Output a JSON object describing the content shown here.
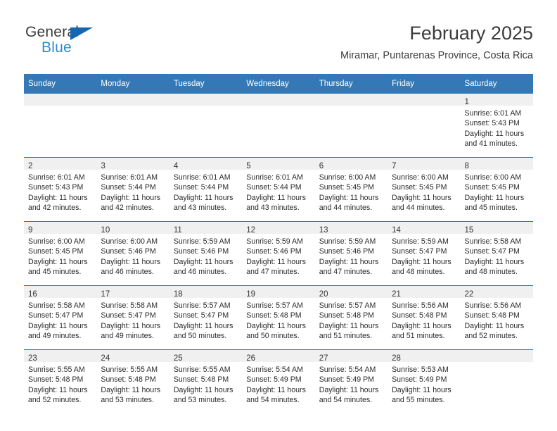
{
  "brand": {
    "name_top": "General",
    "name_bottom": "Blue",
    "flag_icon": "blue-triangle-flag",
    "accent_dark": "#1567b2",
    "accent_light": "#2b8ccc"
  },
  "header": {
    "title": "February 2025",
    "subtitle": "Miramar, Puntarenas Province, Costa Rica"
  },
  "theme": {
    "header_row_bg": "#3479b5",
    "header_row_text": "#ffffff",
    "daynum_band_bg": "#f0f0f0",
    "row_divider": "#3479b5"
  },
  "weekdays": [
    "Sunday",
    "Monday",
    "Tuesday",
    "Wednesday",
    "Thursday",
    "Friday",
    "Saturday"
  ],
  "weeks": [
    [
      {
        "day": "",
        "empty": true
      },
      {
        "day": "",
        "empty": true
      },
      {
        "day": "",
        "empty": true
      },
      {
        "day": "",
        "empty": true
      },
      {
        "day": "",
        "empty": true
      },
      {
        "day": "",
        "empty": true
      },
      {
        "day": "1",
        "sunrise": "Sunrise: 6:01 AM",
        "sunset": "Sunset: 5:43 PM",
        "daylight_1": "Daylight: 11 hours",
        "daylight_2": "and 41 minutes."
      }
    ],
    [
      {
        "day": "2",
        "sunrise": "Sunrise: 6:01 AM",
        "sunset": "Sunset: 5:43 PM",
        "daylight_1": "Daylight: 11 hours",
        "daylight_2": "and 42 minutes."
      },
      {
        "day": "3",
        "sunrise": "Sunrise: 6:01 AM",
        "sunset": "Sunset: 5:44 PM",
        "daylight_1": "Daylight: 11 hours",
        "daylight_2": "and 42 minutes."
      },
      {
        "day": "4",
        "sunrise": "Sunrise: 6:01 AM",
        "sunset": "Sunset: 5:44 PM",
        "daylight_1": "Daylight: 11 hours",
        "daylight_2": "and 43 minutes."
      },
      {
        "day": "5",
        "sunrise": "Sunrise: 6:01 AM",
        "sunset": "Sunset: 5:44 PM",
        "daylight_1": "Daylight: 11 hours",
        "daylight_2": "and 43 minutes."
      },
      {
        "day": "6",
        "sunrise": "Sunrise: 6:00 AM",
        "sunset": "Sunset: 5:45 PM",
        "daylight_1": "Daylight: 11 hours",
        "daylight_2": "and 44 minutes."
      },
      {
        "day": "7",
        "sunrise": "Sunrise: 6:00 AM",
        "sunset": "Sunset: 5:45 PM",
        "daylight_1": "Daylight: 11 hours",
        "daylight_2": "and 44 minutes."
      },
      {
        "day": "8",
        "sunrise": "Sunrise: 6:00 AM",
        "sunset": "Sunset: 5:45 PM",
        "daylight_1": "Daylight: 11 hours",
        "daylight_2": "and 45 minutes."
      }
    ],
    [
      {
        "day": "9",
        "sunrise": "Sunrise: 6:00 AM",
        "sunset": "Sunset: 5:45 PM",
        "daylight_1": "Daylight: 11 hours",
        "daylight_2": "and 45 minutes."
      },
      {
        "day": "10",
        "sunrise": "Sunrise: 6:00 AM",
        "sunset": "Sunset: 5:46 PM",
        "daylight_1": "Daylight: 11 hours",
        "daylight_2": "and 46 minutes."
      },
      {
        "day": "11",
        "sunrise": "Sunrise: 5:59 AM",
        "sunset": "Sunset: 5:46 PM",
        "daylight_1": "Daylight: 11 hours",
        "daylight_2": "and 46 minutes."
      },
      {
        "day": "12",
        "sunrise": "Sunrise: 5:59 AM",
        "sunset": "Sunset: 5:46 PM",
        "daylight_1": "Daylight: 11 hours",
        "daylight_2": "and 47 minutes."
      },
      {
        "day": "13",
        "sunrise": "Sunrise: 5:59 AM",
        "sunset": "Sunset: 5:46 PM",
        "daylight_1": "Daylight: 11 hours",
        "daylight_2": "and 47 minutes."
      },
      {
        "day": "14",
        "sunrise": "Sunrise: 5:59 AM",
        "sunset": "Sunset: 5:47 PM",
        "daylight_1": "Daylight: 11 hours",
        "daylight_2": "and 48 minutes."
      },
      {
        "day": "15",
        "sunrise": "Sunrise: 5:58 AM",
        "sunset": "Sunset: 5:47 PM",
        "daylight_1": "Daylight: 11 hours",
        "daylight_2": "and 48 minutes."
      }
    ],
    [
      {
        "day": "16",
        "sunrise": "Sunrise: 5:58 AM",
        "sunset": "Sunset: 5:47 PM",
        "daylight_1": "Daylight: 11 hours",
        "daylight_2": "and 49 minutes."
      },
      {
        "day": "17",
        "sunrise": "Sunrise: 5:58 AM",
        "sunset": "Sunset: 5:47 PM",
        "daylight_1": "Daylight: 11 hours",
        "daylight_2": "and 49 minutes."
      },
      {
        "day": "18",
        "sunrise": "Sunrise: 5:57 AM",
        "sunset": "Sunset: 5:47 PM",
        "daylight_1": "Daylight: 11 hours",
        "daylight_2": "and 50 minutes."
      },
      {
        "day": "19",
        "sunrise": "Sunrise: 5:57 AM",
        "sunset": "Sunset: 5:48 PM",
        "daylight_1": "Daylight: 11 hours",
        "daylight_2": "and 50 minutes."
      },
      {
        "day": "20",
        "sunrise": "Sunrise: 5:57 AM",
        "sunset": "Sunset: 5:48 PM",
        "daylight_1": "Daylight: 11 hours",
        "daylight_2": "and 51 minutes."
      },
      {
        "day": "21",
        "sunrise": "Sunrise: 5:56 AM",
        "sunset": "Sunset: 5:48 PM",
        "daylight_1": "Daylight: 11 hours",
        "daylight_2": "and 51 minutes."
      },
      {
        "day": "22",
        "sunrise": "Sunrise: 5:56 AM",
        "sunset": "Sunset: 5:48 PM",
        "daylight_1": "Daylight: 11 hours",
        "daylight_2": "and 52 minutes."
      }
    ],
    [
      {
        "day": "23",
        "sunrise": "Sunrise: 5:55 AM",
        "sunset": "Sunset: 5:48 PM",
        "daylight_1": "Daylight: 11 hours",
        "daylight_2": "and 52 minutes."
      },
      {
        "day": "24",
        "sunrise": "Sunrise: 5:55 AM",
        "sunset": "Sunset: 5:48 PM",
        "daylight_1": "Daylight: 11 hours",
        "daylight_2": "and 53 minutes."
      },
      {
        "day": "25",
        "sunrise": "Sunrise: 5:55 AM",
        "sunset": "Sunset: 5:48 PM",
        "daylight_1": "Daylight: 11 hours",
        "daylight_2": "and 53 minutes."
      },
      {
        "day": "26",
        "sunrise": "Sunrise: 5:54 AM",
        "sunset": "Sunset: 5:49 PM",
        "daylight_1": "Daylight: 11 hours",
        "daylight_2": "and 54 minutes."
      },
      {
        "day": "27",
        "sunrise": "Sunrise: 5:54 AM",
        "sunset": "Sunset: 5:49 PM",
        "daylight_1": "Daylight: 11 hours",
        "daylight_2": "and 54 minutes."
      },
      {
        "day": "28",
        "sunrise": "Sunrise: 5:53 AM",
        "sunset": "Sunset: 5:49 PM",
        "daylight_1": "Daylight: 11 hours",
        "daylight_2": "and 55 minutes."
      },
      {
        "day": "",
        "empty": true
      }
    ]
  ]
}
